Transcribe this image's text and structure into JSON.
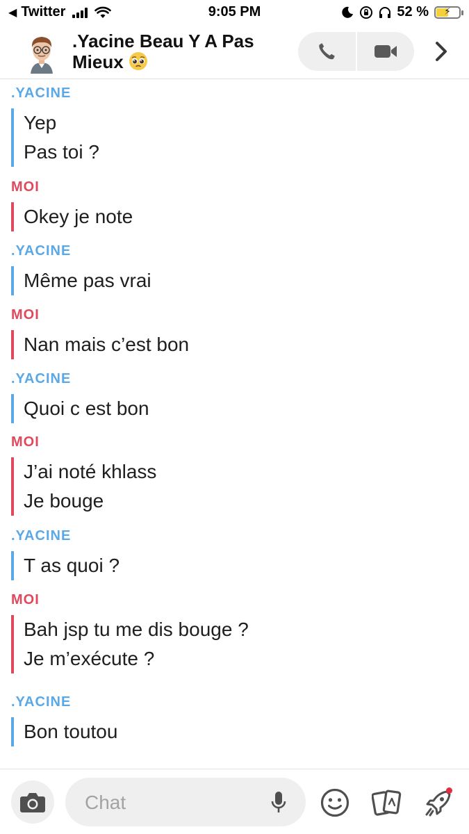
{
  "status_bar": {
    "back_app": "Twitter",
    "time": "9:05 PM",
    "battery_text": "52 %",
    "battery_level_percent": 52
  },
  "header": {
    "title": ".Yacine Beau Y A Pas Mieux",
    "title_emoji": "pleading-face",
    "icons": [
      "phone-icon",
      "video-camera-icon",
      "chevron-right-icon"
    ]
  },
  "messages": [
    {
      "sender": ".YACINE",
      "side": "yacine",
      "lines": [
        "Yep",
        "Pas toi ?"
      ]
    },
    {
      "sender": "MOI",
      "side": "moi",
      "lines": [
        "Okey je note"
      ]
    },
    {
      "sender": ".YACINE",
      "side": "yacine",
      "lines": [
        "Même pas vrai"
      ]
    },
    {
      "sender": "MOI",
      "side": "moi",
      "lines": [
        "Nan mais c’est bon"
      ]
    },
    {
      "sender": ".YACINE",
      "side": "yacine",
      "lines": [
        "Quoi c est bon"
      ]
    },
    {
      "sender": "MOI",
      "side": "moi",
      "lines": [
        "J’ai noté khlass",
        "Je bouge"
      ]
    },
    {
      "sender": ".YACINE",
      "side": "yacine",
      "lines": [
        "T as quoi ?"
      ]
    },
    {
      "sender": "MOI",
      "side": "moi",
      "lines": [
        "Bah jsp tu me dis bouge ?",
        "Je m’exécute ?"
      ]
    },
    {
      "sender": ".YACINE",
      "side": "yacine",
      "lines": [
        "Bon toutou"
      ]
    }
  ],
  "composer": {
    "placeholder": "Chat",
    "icons": [
      "camera-icon",
      "microphone-icon",
      "smiley-icon",
      "cards-icon",
      "rocket-icon"
    ]
  },
  "colors": {
    "yacine": "#5aa8e6",
    "moi": "#e0495d",
    "pill_bg": "#efefef"
  }
}
